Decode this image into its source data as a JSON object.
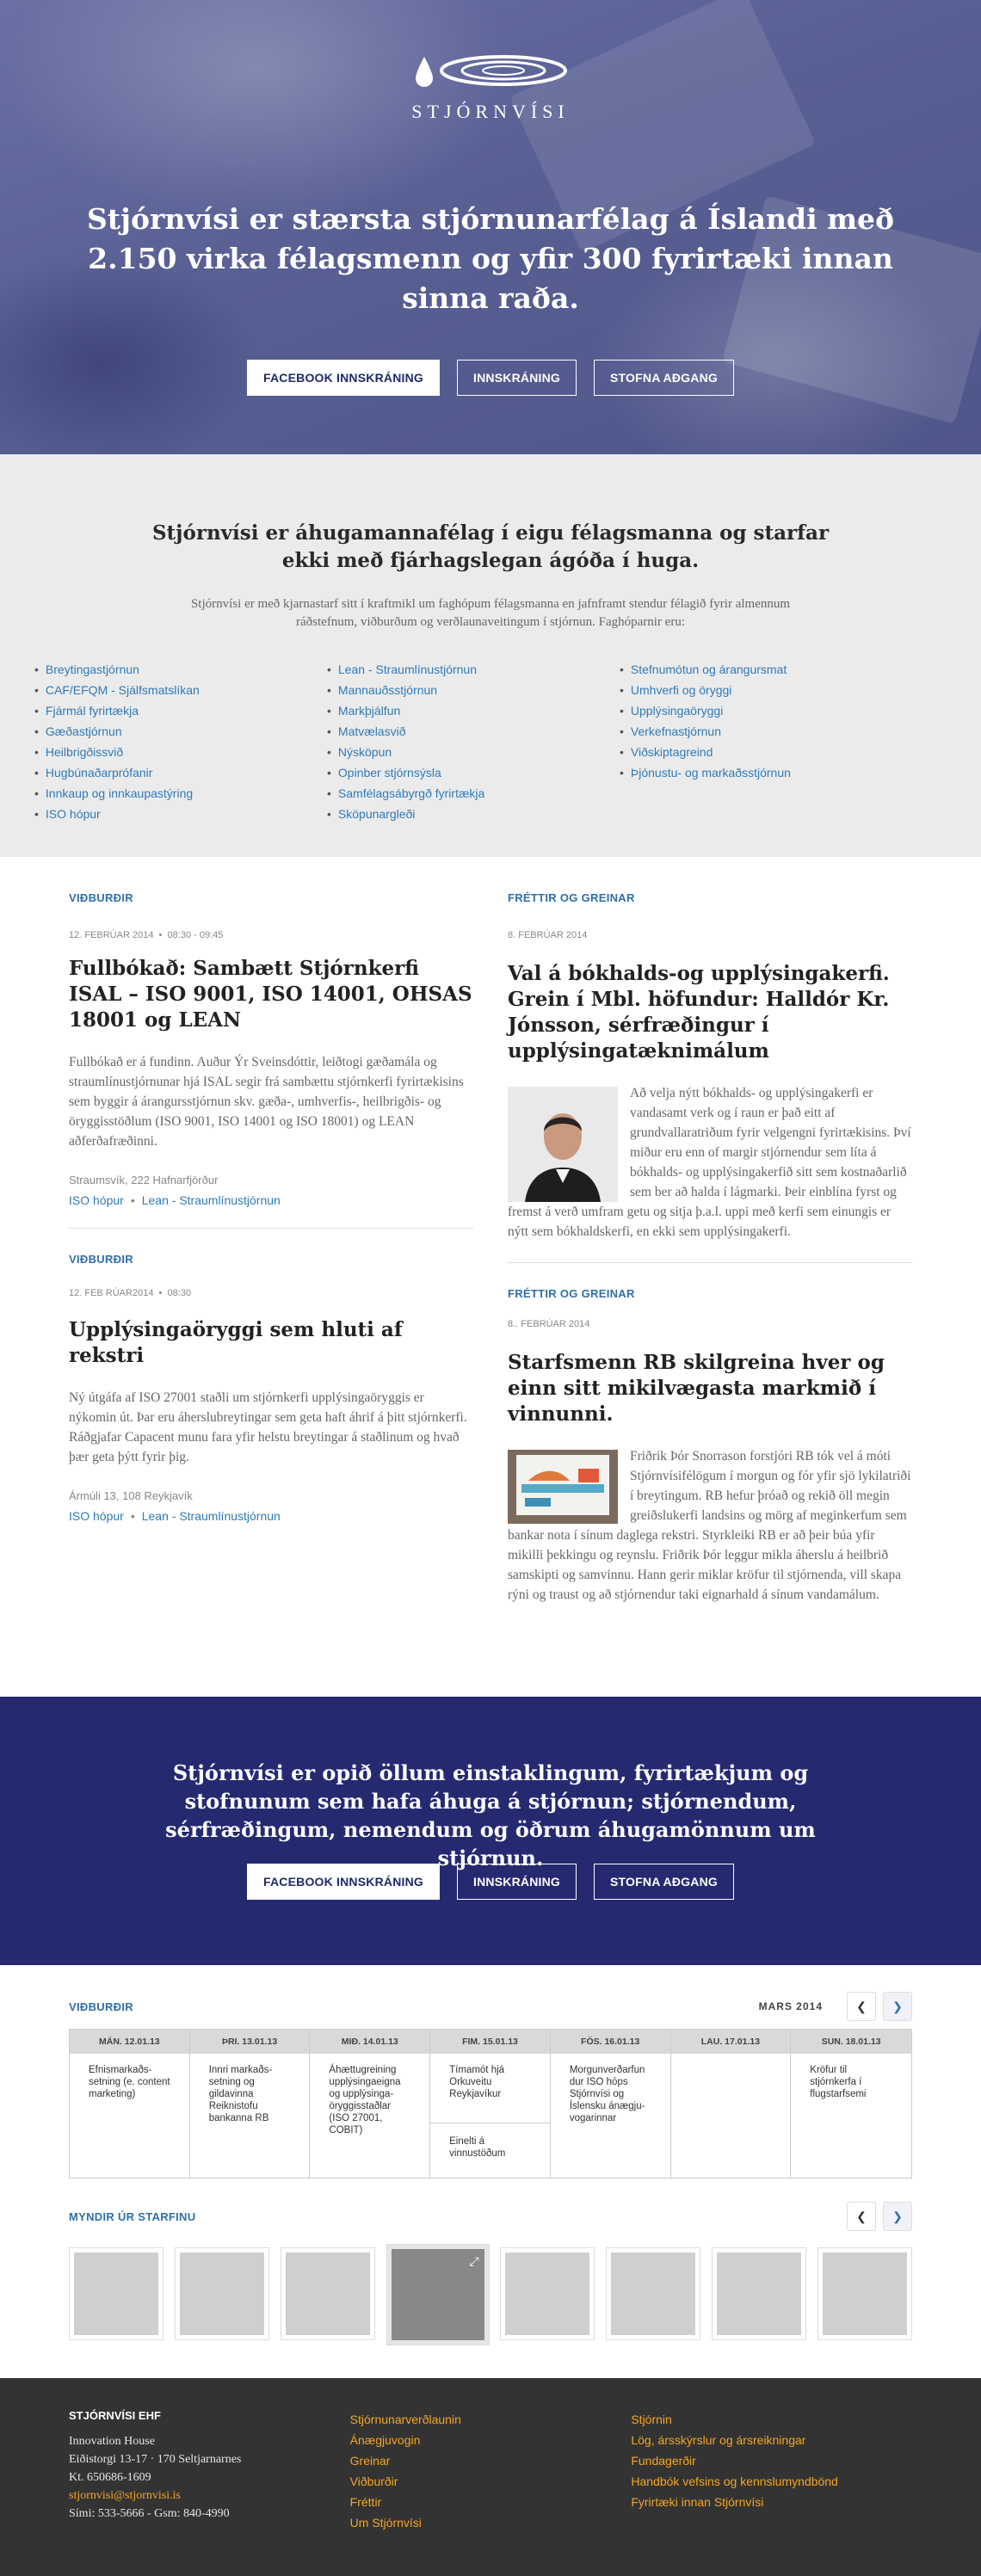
{
  "hero": {
    "logo_text": "STJÓRNVÍSI",
    "title": "Stjórnvísi er stærsta stjórnunarfélag á Íslandi með 2.150 virka félagsmenn og yfir 300 fyrirtæki innan sinna raða.",
    "buttons": {
      "facebook": "FACEBOOK INNSKRÁNING",
      "login": "INNSKRÁNING",
      "create": "STOFNA AÐGANG"
    }
  },
  "intro": {
    "title": "Stjórnvísi er áhugamannafélag í eigu félagsmanna og starfar ekki með fjárhagslegan ágóða í huga.",
    "text": "Stjórnvísi er með kjarnastarf sitt í kraftmikl um faghópum félagsmanna en jafnframt stendur félagið fyrir almennum ráðstefnum, viðburðum og verðlaunaveitingum í stjórnun. Faghóparnir eru:",
    "groups": [
      [
        "Breytingastjórnun",
        "CAF/EFQM - Sjálfsmatslíkan",
        "Fjármál fyrirtækja",
        "Gæðastjórnun",
        "Heilbrigðissvið",
        "Hugbúnaðarprófanir",
        "Innkaup og innkaupastýring",
        "ISO hópur"
      ],
      [
        "Lean - Straumlínustjórnun",
        "Mannauðsstjórnun",
        "Markþjálfun",
        "Matvælasvið",
        "Nýsköpun",
        "Opinber stjórnsýsla",
        "Samfélagsábyrgð fyrirtækja",
        "Sköpunargleði"
      ],
      [
        "Stefnumótun og árangursmat",
        "Umhverfi og öryggi",
        "Upplýsingaöryggi",
        "Verkefnastjórnun",
        "Viðskiptagreind",
        "Þjónustu- og markaðsstjórnun"
      ]
    ]
  },
  "events": [
    {
      "section": "VIÐBURÐIR",
      "date": "12. FEBRÚAR 2014",
      "time": "08:30 - 09:45",
      "title": "Fullbókað: Sambætt Stjórnkerfi ISAL – ISO 9001, ISO 14001, OHSAS 18001 og LEAN",
      "body": "Fullbókað er á fundinn. Auður Ýr Sveinsdóttir, leiðtogi gæðamála og straumlínustjórnunar hjá ISAL segir frá sambættu stjórnkerfi fyrirtækisins sem byggir á árangursstjórnun skv. gæða-, umhverfis-, heilbrigðis- og öryggisstöðlum (ISO 9001, ISO 14001 og ISO 18001) og LEAN aðferðafræðinni.",
      "location": "Straumsvík, 222 Hafnarfjörður",
      "tag1": "ISO hópur",
      "tag2": "Lean - Straumlínustjórnun"
    },
    {
      "section": "VIÐBURÐIR",
      "date": "12. FEB RÚAR2014",
      "time": "08:30",
      "title": "Upplýsingaöryggi sem hluti af rekstri",
      "body": "Ný útgáfa af ISO 27001 staðli um stjórnkerfi upplýsingaöryggis er nýkomin út. Þar eru áherslubreytingar sem geta haft áhrif á þitt stjórnkerfi. Ráðgjafar Capacent munu fara yfir helstu breytingar á staðlinum og hvað þær geta þýtt fyrir þig.",
      "location": "Ármúli 13, 108 Reykjavík",
      "tag1": "ISO hópur",
      "tag2": "Lean - Straumlínustjórnun"
    }
  ],
  "news": [
    {
      "section": "FRÉTTIR OG GREINAR",
      "date": "8. FEBRÚAR 2014",
      "title": "Val á bókhalds-og upplýsingakerfi. Grein í Mbl. höfundur: Halldór Kr. Jónsson, sérfræðingur í upplýsingatæknimálum",
      "body": "Að velja nýtt bókhalds- og upplýsingakerfi er vandasamt verk og í raun er það eitt af grundvallaratriðum fyrir velgengni fyrirtækisins. Því miður eru enn of margir stjórnendur sem líta á bókhalds- og upplýsingakerfið sitt sem kostnaðarlið sem ber að halda í lágmarki. Þeir einblína fyrst og fremst á verð umfram getu og sitja þ.a.l. uppi með kerfi sem einungis er nýtt sem bókhaldskerfi, en ekki sem upplýsingakerfi."
    },
    {
      "section": "FRÉTTIR OG GREINAR",
      "date": "8.. FEBRÚAR 2014",
      "title": "Starfsmenn RB skilgreina hver og einn sitt mikilvægasta markmið í vinnunni.",
      "body": "Friðrik Þór Snorrason forstjóri RB tók vel á móti Stjórnvísifélögum í morgun og fór yfir sjö lykilatriði í breytingum. RB hefur þróað og rekið öll megin greiðslukerfi landsins og mörg af meginkerfum sem bankar nota í sínum daglega rekstri. Styrkleiki RB er að þeir búa yfir mikilli þekkingu og reynslu. Friðrik Þór leggur mikla áherslu á heilbrið samskipti og samvinnu. Hann gerir miklar kröfur til stjórnenda, vill skapa rýni og traust og að stjórnendur taki eignarhald á sínum vandamálum."
    }
  ],
  "cta": {
    "title": "Stjórnvísi er opið öllum einstaklingum, fyrirtækjum og stofnunum sem hafa áhuga á stjórnun; stjórnendum, sérfræðingum, nemendum og öðrum áhugamönnum um stjórnun.",
    "buttons": {
      "facebook": "FACEBOOK INNSKRÁNING",
      "login": "INNSKRÁNING",
      "create": "STOFNA AÐGANG"
    }
  },
  "calendar": {
    "section": "VIÐBURÐIR",
    "month": "MARS 2014",
    "prev_icon": "chevron-left-icon",
    "next_icon": "chevron-right-icon",
    "days": [
      {
        "label": "MÁN. 12.01.13",
        "events": [
          "Efnismarkaðs-setning (e. content marketing)"
        ]
      },
      {
        "label": "ÞRI. 13.01.13",
        "events": [
          "Innri markaðs-setning og gildavinna Reiknistofu bankanna RB"
        ]
      },
      {
        "label": "MIÐ. 14.01.13",
        "events": [
          "Áhættugreining upplýsingaeigna og upplýsinga-öryggisstaðlar (ISO 27001, COBIT)"
        ]
      },
      {
        "label": "FIM. 15.01.13",
        "events": [
          "Tímamót hjá Orkuveitu Reykjavíkur",
          "Einelti á vinnustöðum"
        ]
      },
      {
        "label": "FÖS. 16.01.13",
        "events": [
          "Morgunverðarfun dur ISO hóps Stjórnvísi og Íslensku ánægju-vogarinnar"
        ]
      },
      {
        "label": "LAU. 17.01.13",
        "events": []
      },
      {
        "label": "SUN. 18.01.13",
        "events": [
          "Kröfur til stjórnkerfa í flugstarfsemi"
        ]
      }
    ]
  },
  "photos": {
    "section": "MYNDIR ÚR STARFINU",
    "count": 8,
    "active_index": 3,
    "expand_icon": "expand-icon"
  },
  "footer": {
    "company": "STJÓRNVÍSI EHF",
    "address": [
      "Innovation House",
      "Eiðistorgi 13-17 · 170 Seltjarnarnes",
      "Kt. 650686-1609"
    ],
    "email": "stjornvisi@stjornvisi.is",
    "phone": "Sími: 533-5666 - Gsm: 840-4990",
    "links_col1": [
      "Stjórnunarverðlaunin",
      "Ánægjuvogin",
      "Greinar",
      "Viðburðir",
      "Fréttir",
      "Um Stjórnvísi"
    ],
    "links_col2": [
      "Stjórnin",
      "Lög, ársskýrslur og ársreikningar",
      "Fundagerðir",
      "Handbók vefsins og kennslumyndbönd",
      "Fyrirtæki innan Stjórnvísi"
    ]
  }
}
